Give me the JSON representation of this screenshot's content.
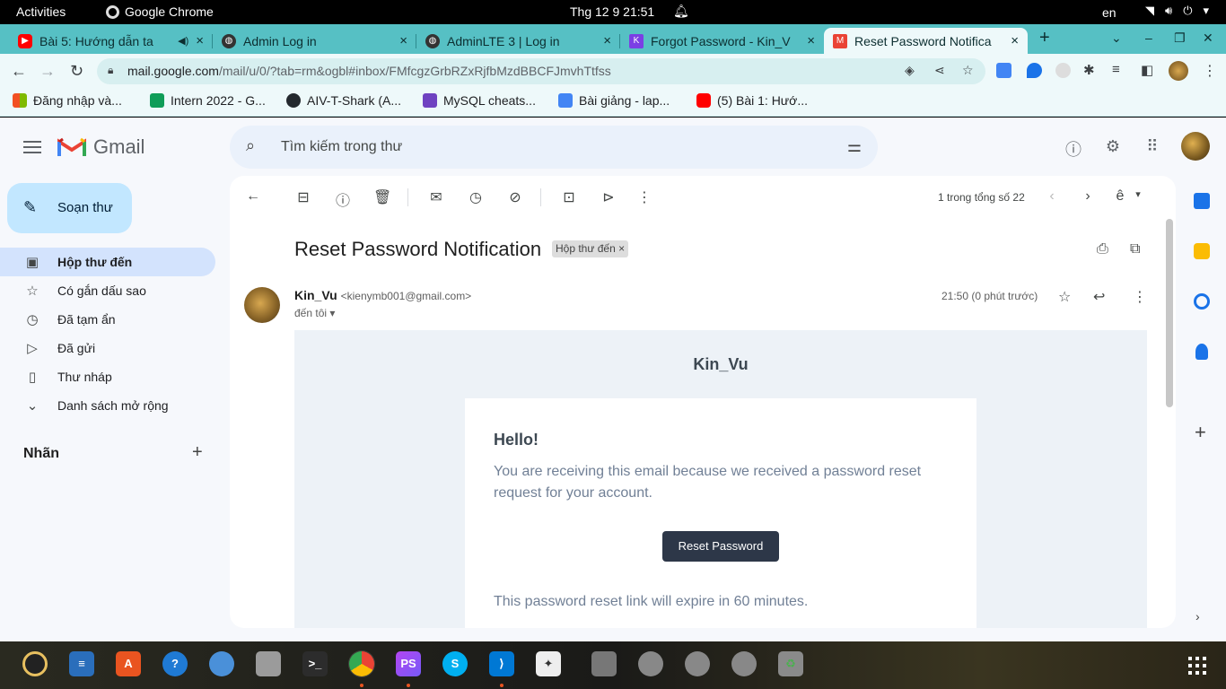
{
  "system": {
    "activities": "Activities",
    "app_name": "Google Chrome",
    "clock": "Thg 12 9  21:51",
    "lang": "en"
  },
  "tabs": [
    {
      "title": "Bài 5: Hướng dẫn ta",
      "icon_color": "#ff0000"
    },
    {
      "title": "Admin Log in",
      "icon_color": "#333333"
    },
    {
      "title": "AdminLTE 3 | Log in",
      "icon_color": "#333333"
    },
    {
      "title": "Forgot Password - Kin_V",
      "icon_color": "#7b3fe4"
    },
    {
      "title": "Reset Password Notifica",
      "icon_color": "#ea4335"
    }
  ],
  "address": {
    "host": "mail.google.com",
    "path": "/mail/u/0/?tab=rm&ogbl#inbox/FMfcgzGrbRZxRjfbMzdBBCFJmvhTtfss"
  },
  "bookmarks": [
    {
      "label": "Đăng nhập và...",
      "color": "#f25022"
    },
    {
      "label": "Intern 2022 - G...",
      "color": "#0f9d58"
    },
    {
      "label": "AIV-T-Shark (A...",
      "color": "#24292e"
    },
    {
      "label": "MySQL cheats...",
      "color": "#6f42c1"
    },
    {
      "label": "Bài giảng - lap...",
      "color": "#4285f4"
    },
    {
      "label": "(5) Bài 1: Hướ...",
      "color": "#ff0000"
    }
  ],
  "gmail": {
    "brand": "Gmail",
    "search_placeholder": "Tìm kiếm trong thư",
    "compose": "Soạn thư",
    "nav": [
      {
        "label": "Hộp thư đến",
        "icon": "inbox-icon",
        "active": true
      },
      {
        "label": "Có gắn dấu sao",
        "icon": "star-icon"
      },
      {
        "label": "Đã tạm ẩn",
        "icon": "clock-icon"
      },
      {
        "label": "Đã gửi",
        "icon": "send-icon"
      },
      {
        "label": "Thư nháp",
        "icon": "draft-icon"
      },
      {
        "label": "Danh sách mở rộng",
        "icon": "chevron-down-icon"
      }
    ],
    "labels_heading": "Nhãn"
  },
  "message": {
    "pager": "1 trong tổng số 22",
    "subject": "Reset Password Notification",
    "chip": "Hộp thư đến",
    "sender_name": "Kin_Vu",
    "sender_email": "<kienymb001@gmail.com>",
    "to": "đến tôi",
    "time": "21:50 (0 phút trước)"
  },
  "email_body": {
    "brand": "Kin_Vu",
    "greeting": "Hello!",
    "line1": "You are receiving this email because we received a password reset request for your account.",
    "button": "Reset Password",
    "line2": "This password reset link will expire in 60 minutes."
  }
}
